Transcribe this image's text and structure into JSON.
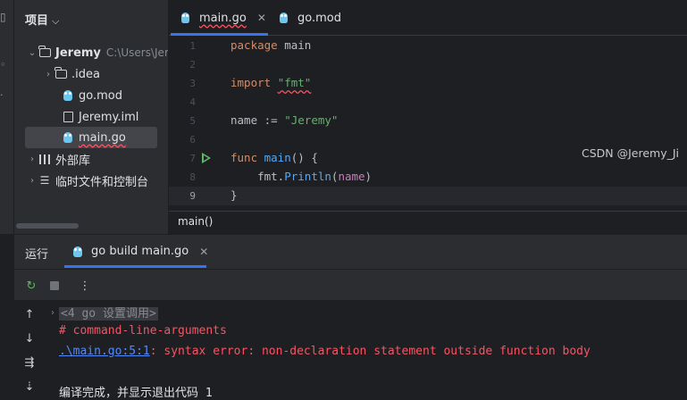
{
  "project_panel": {
    "title": "项目",
    "chevron": "⌵",
    "tree": [
      {
        "label": "Jeremy",
        "extra": "C:\\Users\\Jer",
        "icon": "folder-icon",
        "expanded": true
      },
      {
        "label": ".idea",
        "icon": "folder-icon",
        "expanded": false
      },
      {
        "label": "go.mod",
        "icon": "go-file-icon"
      },
      {
        "label": "Jeremy.iml",
        "icon": "iml-file-icon"
      },
      {
        "label": "main.go",
        "icon": "go-file-icon",
        "selected": true
      },
      {
        "label": "外部库",
        "icon": "library-icon",
        "expanded": false
      },
      {
        "label": "临时文件和控制台",
        "icon": "scratch-icon",
        "expanded": false
      }
    ]
  },
  "editor": {
    "tabs": [
      {
        "label": "main.go",
        "active": true,
        "close": "✕"
      },
      {
        "label": "go.mod",
        "active": false
      }
    ],
    "line_numbers": [
      "1",
      "2",
      "3",
      "4",
      "5",
      "6",
      "7",
      "8",
      "9"
    ],
    "code": {
      "l1_kw": "package",
      "l1_rest": " main",
      "l3_kw": "import",
      "l3_str": "\"fmt\"",
      "l5_name": "name := ",
      "l5_str": "\"Jeremy\"",
      "l7_kw": "func",
      "l7_fn": " main",
      "l7_rest": "() {",
      "l8_pkg": "    fmt.",
      "l8_fn": "Println",
      "l8_open": "(",
      "l8_param": "name",
      "l8_close": ")",
      "l9": "}"
    },
    "breadcrumb": "main()"
  },
  "run_panel": {
    "title": "运行",
    "tab_label": "go build main.go",
    "tab_close": "✕",
    "console": {
      "header": "<4 go 设置调用>",
      "line2": "# command-line-arguments",
      "line3_link": ".\\main.go:5:1",
      "line3_rest": ": syntax error: non-declaration statement outside function body",
      "line5": "编译完成，并显示退出代码 1"
    }
  },
  "watermark": "CSDN @Jeremy_Ji",
  "colors": {
    "accent": "#3574f0",
    "error": "#f75464",
    "keyword": "#cf8e6d",
    "string": "#6aab73",
    "function": "#56a8f5"
  }
}
